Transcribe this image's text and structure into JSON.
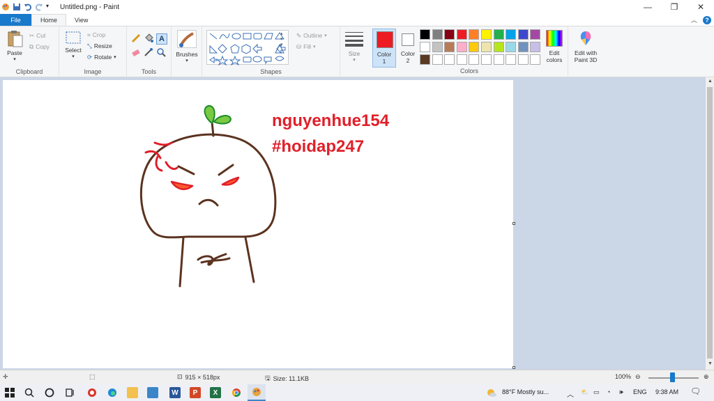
{
  "window": {
    "title": "Untitled.png - Paint"
  },
  "tabs": [
    {
      "label": "File"
    },
    {
      "label": "Home"
    },
    {
      "label": "View"
    }
  ],
  "ribbon": {
    "clipboard": {
      "paste": "Paste",
      "cut": "Cut",
      "copy": "Copy",
      "label": "Clipboard"
    },
    "image": {
      "select": "Select",
      "crop": "Crop",
      "resize": "Resize",
      "rotate": "Rotate",
      "label": "Image"
    },
    "tools": {
      "label": "Tools"
    },
    "brushes": {
      "label": "Brushes"
    },
    "shapes": {
      "outline": "Outline",
      "fill": "Fill",
      "label": "Shapes"
    },
    "size": {
      "label": "Size"
    },
    "color1": {
      "label1": "Color",
      "label2": "1",
      "value": "#ed1c24"
    },
    "color2": {
      "label1": "Color",
      "label2": "2",
      "value": "#ffffff"
    },
    "colors": {
      "label": "Colors",
      "palette_row1": [
        "#000000",
        "#7f7f7f",
        "#880015",
        "#ed1c24",
        "#ff7f27",
        "#fff200",
        "#22b14c",
        "#00a2e8",
        "#3f48cc",
        "#a349a4"
      ],
      "palette_row2": [
        "#ffffff",
        "#c3c3c3",
        "#b97a57",
        "#ffaec9",
        "#ffc90e",
        "#efe4b0",
        "#b5e61d",
        "#99d9ea",
        "#7092be",
        "#c8bfe7"
      ],
      "palette_row3": [
        "#5a3a22",
        "#ffffff",
        "#ffffff",
        "#ffffff",
        "#ffffff",
        "#ffffff",
        "#ffffff",
        "#ffffff",
        "#ffffff",
        "#ffffff"
      ]
    },
    "edit_colors": {
      "label1": "Edit",
      "label2": "colors"
    },
    "paint3d": {
      "label1": "Edit with",
      "label2": "Paint 3D"
    }
  },
  "canvas": {
    "text_line1": "nguyenhue154",
    "text_line2": "#hoidap247",
    "text_color": "#e0202a",
    "stroke_color": "#5b3320"
  },
  "status": {
    "dimensions": "915 × 518px",
    "size": "Size: 11.1KB",
    "zoom": "100%"
  },
  "taskbar": {
    "weather": "88°F  Mostly su...",
    "lang": "ENG",
    "time": "9:38 AM"
  }
}
